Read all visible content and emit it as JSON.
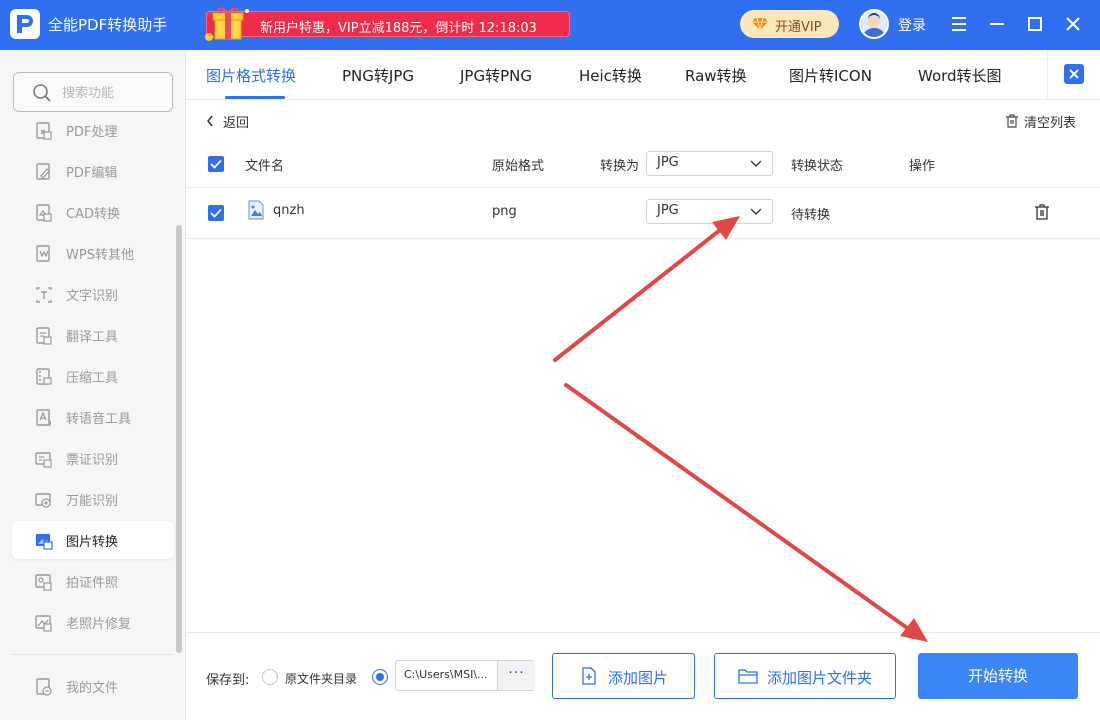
{
  "app": {
    "title": "全能PDF转换助手"
  },
  "promo": {
    "text": "新用户特惠，VIP立减188元，倒计时 12:18:03"
  },
  "header": {
    "vip_label": "开通VIP",
    "login_label": "登录"
  },
  "sidebar": {
    "search_placeholder": "搜索功能",
    "items": [
      {
        "label": "PDF处理",
        "icon": "pdf-process-icon"
      },
      {
        "label": "PDF编辑",
        "icon": "pdf-edit-icon"
      },
      {
        "label": "CAD转换",
        "icon": "cad-convert-icon"
      },
      {
        "label": "WPS转其他",
        "icon": "wps-convert-icon"
      },
      {
        "label": "文字识别",
        "icon": "text-recognition-icon"
      },
      {
        "label": "翻译工具",
        "icon": "translate-icon"
      },
      {
        "label": "压缩工具",
        "icon": "compress-icon"
      },
      {
        "label": "转语音工具",
        "icon": "speech-icon"
      },
      {
        "label": "票证识别",
        "icon": "ticket-recognition-icon"
      },
      {
        "label": "万能识别",
        "icon": "universal-recognition-icon"
      },
      {
        "label": "图片转换",
        "icon": "image-convert-icon",
        "active": true
      },
      {
        "label": "拍证件照",
        "icon": "id-photo-icon"
      },
      {
        "label": "老照片修复",
        "icon": "photo-restore-icon"
      }
    ],
    "my_files": "我的文件"
  },
  "tabs": [
    "图片格式转换",
    "PNG转JPG",
    "JPG转PNG",
    "Heic转换",
    "Raw转换",
    "图片转ICON",
    "Word转长图"
  ],
  "toolbar": {
    "back_label": "返回",
    "clear_label": "清空列表"
  },
  "table": {
    "headers": {
      "filename": "文件名",
      "original_format": "原始格式",
      "convert_to": "转换为",
      "status": "转换状态",
      "action": "操作"
    },
    "convert_to_value": "JPG",
    "rows": [
      {
        "filename": "qnzh",
        "original_format": "png",
        "target": "JPG",
        "status": "待转换"
      }
    ]
  },
  "bottom": {
    "save_to_label": "保存到:",
    "source_dir_label": "原文件夹目录",
    "path": "C:\\Users\\MSI\\...",
    "more": "···",
    "add_image": "添加图片",
    "add_folder": "添加图片文件夹",
    "start": "开始转换"
  },
  "colors": {
    "accent": "#2f6ff0",
    "promo": "#f12b4a",
    "arrow": "#e04848"
  }
}
